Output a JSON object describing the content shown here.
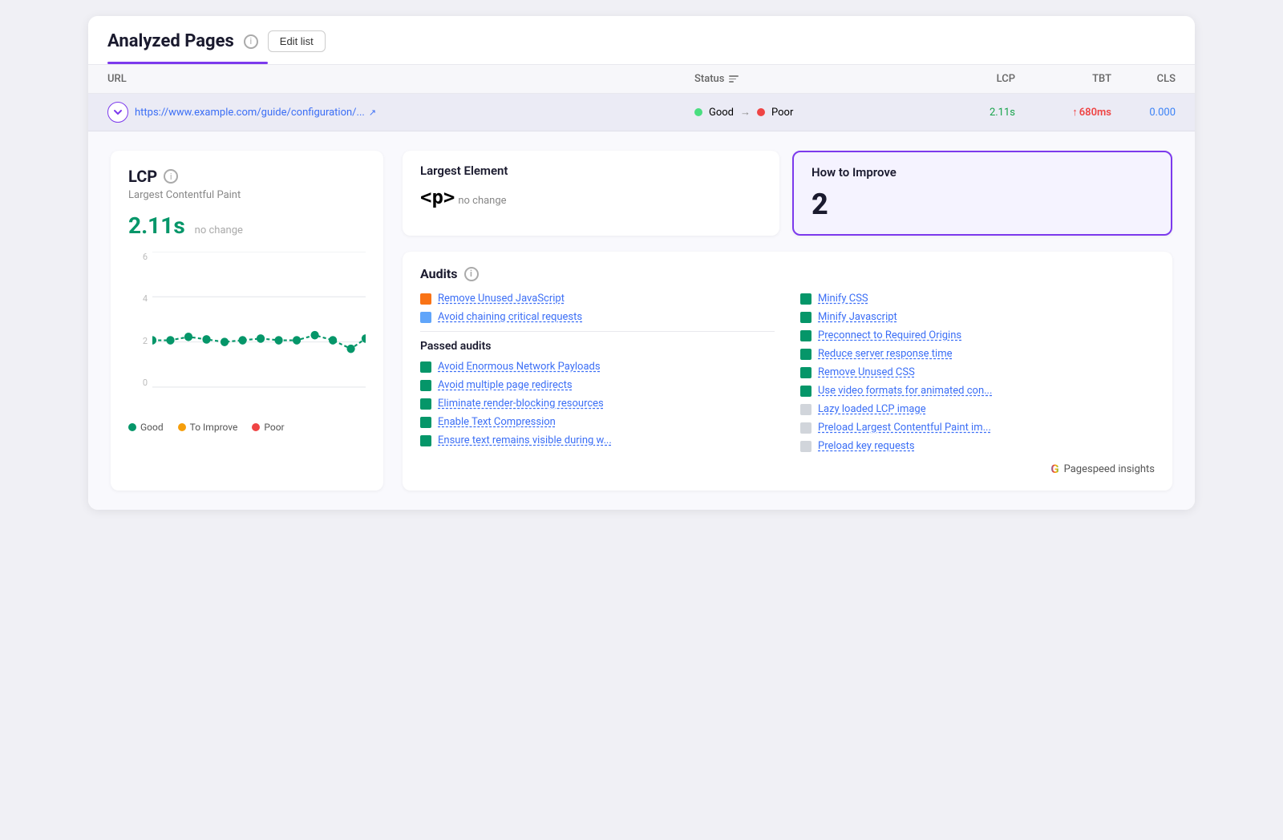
{
  "header": {
    "title": "Analyzed Pages",
    "info_label": "i",
    "edit_button": "Edit list"
  },
  "table": {
    "columns": {
      "url": "URL",
      "status": "Status",
      "lcp": "LCP",
      "tbt": "TBT",
      "cls": "CLS"
    },
    "row": {
      "url": "https://www.example.com/guide/configuration/...",
      "status_from": "Good",
      "status_to": "Poor",
      "lcp": "2.11s",
      "tbt": "680ms",
      "cls": "0.000"
    }
  },
  "lcp_card": {
    "label": "LCP",
    "subtitle": "Largest Contentful Paint",
    "value": "2.11s",
    "change": "no change",
    "y_labels": [
      "6",
      "4",
      "2",
      "0"
    ],
    "legend": [
      {
        "label": "Good",
        "color": "green"
      },
      {
        "label": "To Improve",
        "color": "yellow"
      },
      {
        "label": "Poor",
        "color": "red"
      }
    ]
  },
  "largest_element_card": {
    "title": "Largest Element",
    "element": "<p>",
    "change": "no change"
  },
  "how_to_improve_card": {
    "title": "How to Improve",
    "count": "2"
  },
  "audits": {
    "title": "Audits",
    "items": [
      {
        "label": "Remove Unused JavaScript",
        "color": "orange",
        "type": "fail"
      },
      {
        "label": "Avoid chaining critical requests",
        "color": "blue",
        "type": "fail"
      }
    ],
    "passed_label": "Passed audits",
    "passed_items": [
      {
        "label": "Avoid Enormous Network Payloads",
        "color": "green"
      },
      {
        "label": "Avoid multiple page redirects",
        "color": "green"
      },
      {
        "label": "Eliminate render-blocking resources",
        "color": "green"
      },
      {
        "label": "Enable Text Compression",
        "color": "green"
      },
      {
        "label": "Ensure text remains visible during w...",
        "color": "green"
      }
    ],
    "right_items": [
      {
        "label": "Minify CSS",
        "color": "green"
      },
      {
        "label": "Minify Javascript",
        "color": "green"
      },
      {
        "label": "Preconnect to Required Origins",
        "color": "green"
      },
      {
        "label": "Reduce server response time",
        "color": "green"
      },
      {
        "label": "Remove Unused CSS",
        "color": "green"
      },
      {
        "label": "Use video formats for animated con...",
        "color": "green"
      },
      {
        "label": "Lazy loaded LCP image",
        "color": "gray"
      },
      {
        "label": "Preload Largest Contentful Paint im...",
        "color": "gray"
      },
      {
        "label": "Preload key requests",
        "color": "gray"
      }
    ]
  },
  "pagespeed": {
    "label": "Pagespeed insights"
  }
}
